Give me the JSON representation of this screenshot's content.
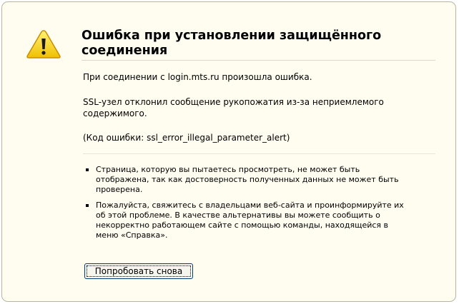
{
  "colors": {
    "panel_background": "#fffcf0",
    "panel_border": "#b8b4a3",
    "warning_icon_fill": "#f4d128",
    "warning_icon_stroke": "#c88d00",
    "button_border": "#003c74"
  },
  "error": {
    "icon": "warning-triangle-icon",
    "title": "Ошибка при установлении защищённого соединения",
    "paragraphs": [
      "При соединении с login.mts.ru произошла ошибка.",
      "SSL-узел отклонил сообщение рукопожатия из-за неприемлемого содержимого.",
      "(Код ошибки: ssl_error_illegal_parameter_alert)"
    ],
    "bullets": [
      "Страница, которую вы пытаетесь просмотреть, не может быть отображена, так как достоверность полученных данных не может быть проверена.",
      "Пожалуйста, свяжитесь с владельцами веб-сайта и проинформируйте их об этой проблеме. В качестве альтернативы вы можете сообщить о некорректно работающем сайте с помощью команды, находящейся в меню «Справка»."
    ],
    "retry_button_label": "Попробовать снова"
  }
}
